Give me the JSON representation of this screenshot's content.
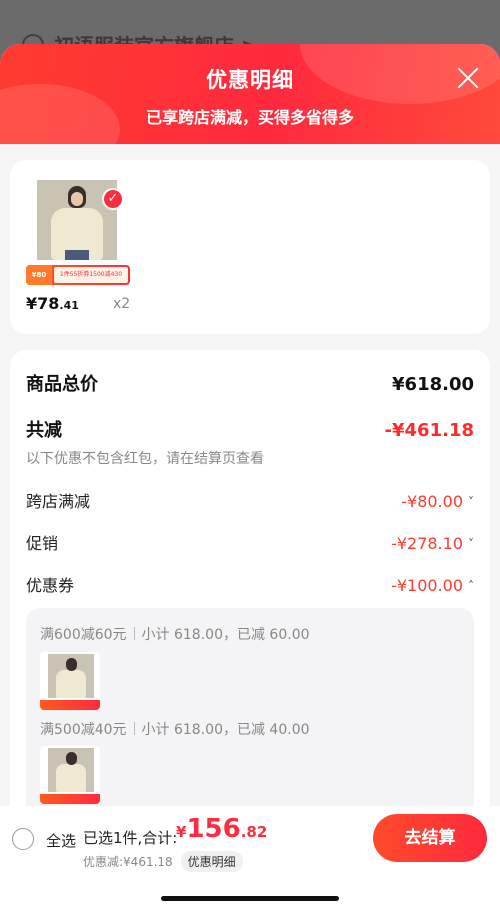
{
  "background": {
    "store_name": "初语服装官方旗舰店 >"
  },
  "sheet": {
    "title": "优惠明细",
    "subtitle": "已享跨店满减，买得多省得多",
    "close_icon": "close-icon"
  },
  "product": {
    "promo_tag_left": "¥80",
    "promo_tag_right": "1件55折券1500减430",
    "price_symbol": "¥",
    "price_int": "78",
    "price_dec": ".41",
    "quantity": "x2",
    "selected": true
  },
  "details": {
    "total_label": "商品总价",
    "total_value": "¥618.00",
    "reduce_label": "共减",
    "reduce_value": "-¥461.18",
    "reduce_note": "以下优惠不包含红包，请在结算页查看",
    "items": [
      {
        "label": "跨店满减",
        "value": "-¥80.00",
        "chevron": "˅"
      },
      {
        "label": "促销",
        "value": "-¥278.10",
        "chevron": "˅"
      },
      {
        "label": "优惠券",
        "value": "-¥100.00",
        "chevron": "˄"
      }
    ],
    "coupons": [
      {
        "rule": "满600减60元",
        "detail": "小计 618.00，已减 60.00"
      },
      {
        "rule": "满500减40元",
        "detail": "小计 618.00，已减 40.00"
      }
    ]
  },
  "bottom": {
    "select_all": "全选",
    "selected_text": "已选1件,合计:",
    "sum_symbol": "¥",
    "sum_int": "156",
    "sum_dec": ".82",
    "discount_text": "优惠减:¥461.18",
    "detail_button": "优惠明细",
    "checkout_button": "去结算"
  },
  "colors": {
    "accent": "#ff2b3e",
    "price_red": "#ff3b2f"
  }
}
